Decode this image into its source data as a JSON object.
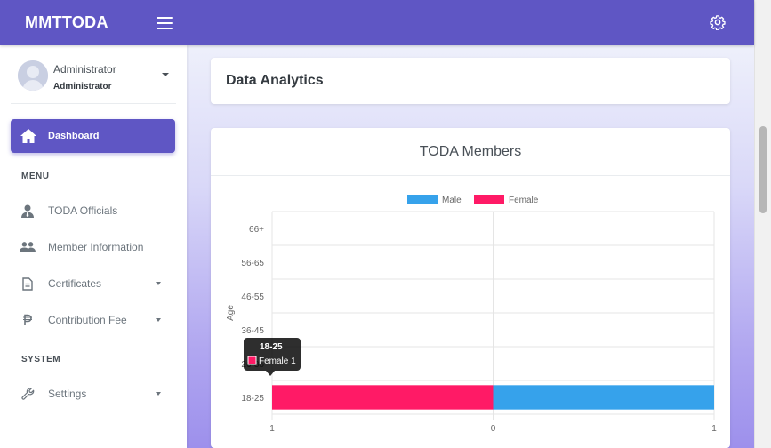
{
  "app": {
    "brand": "MMTTODA"
  },
  "user": {
    "name": "Administrator",
    "role": "Administrator"
  },
  "sidebar": {
    "dashboard_label": "Dashboard",
    "menu_header": "MENU",
    "system_header": "SYSTEM",
    "items": [
      {
        "label": "TODA Officials",
        "icon": "user-tie-icon"
      },
      {
        "label": "Member Information",
        "icon": "users-icon"
      },
      {
        "label": "Certificates",
        "icon": "file-icon"
      },
      {
        "label": "Contribution Fee",
        "icon": "peso-icon"
      },
      {
        "label": "Settings",
        "icon": "wrench-icon"
      }
    ]
  },
  "main": {
    "page_title": "Data Analytics",
    "chart_title": "TODA Members"
  },
  "colors": {
    "accent": "#5f56c4",
    "male": "#36a2eb",
    "female": "#ff1a66"
  },
  "chart_data": {
    "type": "bar",
    "orientation": "horizontal",
    "title": "TODA Members",
    "ylabel": "Age",
    "xlabel": "",
    "categories": [
      "66+",
      "56-65",
      "46-55",
      "36-45",
      "26-35",
      "18-25"
    ],
    "series": [
      {
        "name": "Male",
        "values": [
          0,
          0,
          0,
          0,
          0,
          1
        ]
      },
      {
        "name": "Female",
        "values": [
          0,
          0,
          0,
          0,
          0,
          -1
        ]
      }
    ],
    "x_ticks": [
      "1",
      "0",
      "1"
    ],
    "xlim": [
      -1,
      1
    ],
    "stacked": true,
    "legend": "top",
    "grid": true,
    "tooltip": {
      "title": "18-25",
      "label": "Female 1"
    }
  }
}
